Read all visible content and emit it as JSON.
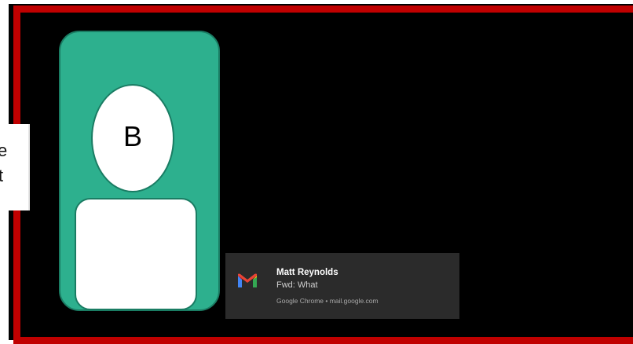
{
  "side_panel": {
    "fragment_top": "e",
    "fragment_bottom": "t"
  },
  "avatar": {
    "initial": "B"
  },
  "notification": {
    "app_icon": "gmail-icon",
    "title": "Matt Reynolds",
    "message": "Fwd: What",
    "source": "Google Chrome • mail.google.com"
  },
  "colors": {
    "frame_border": "#c00000",
    "avatar_card": "#2db08e",
    "background": "#000000",
    "toast_background": "#2b2b2b"
  }
}
